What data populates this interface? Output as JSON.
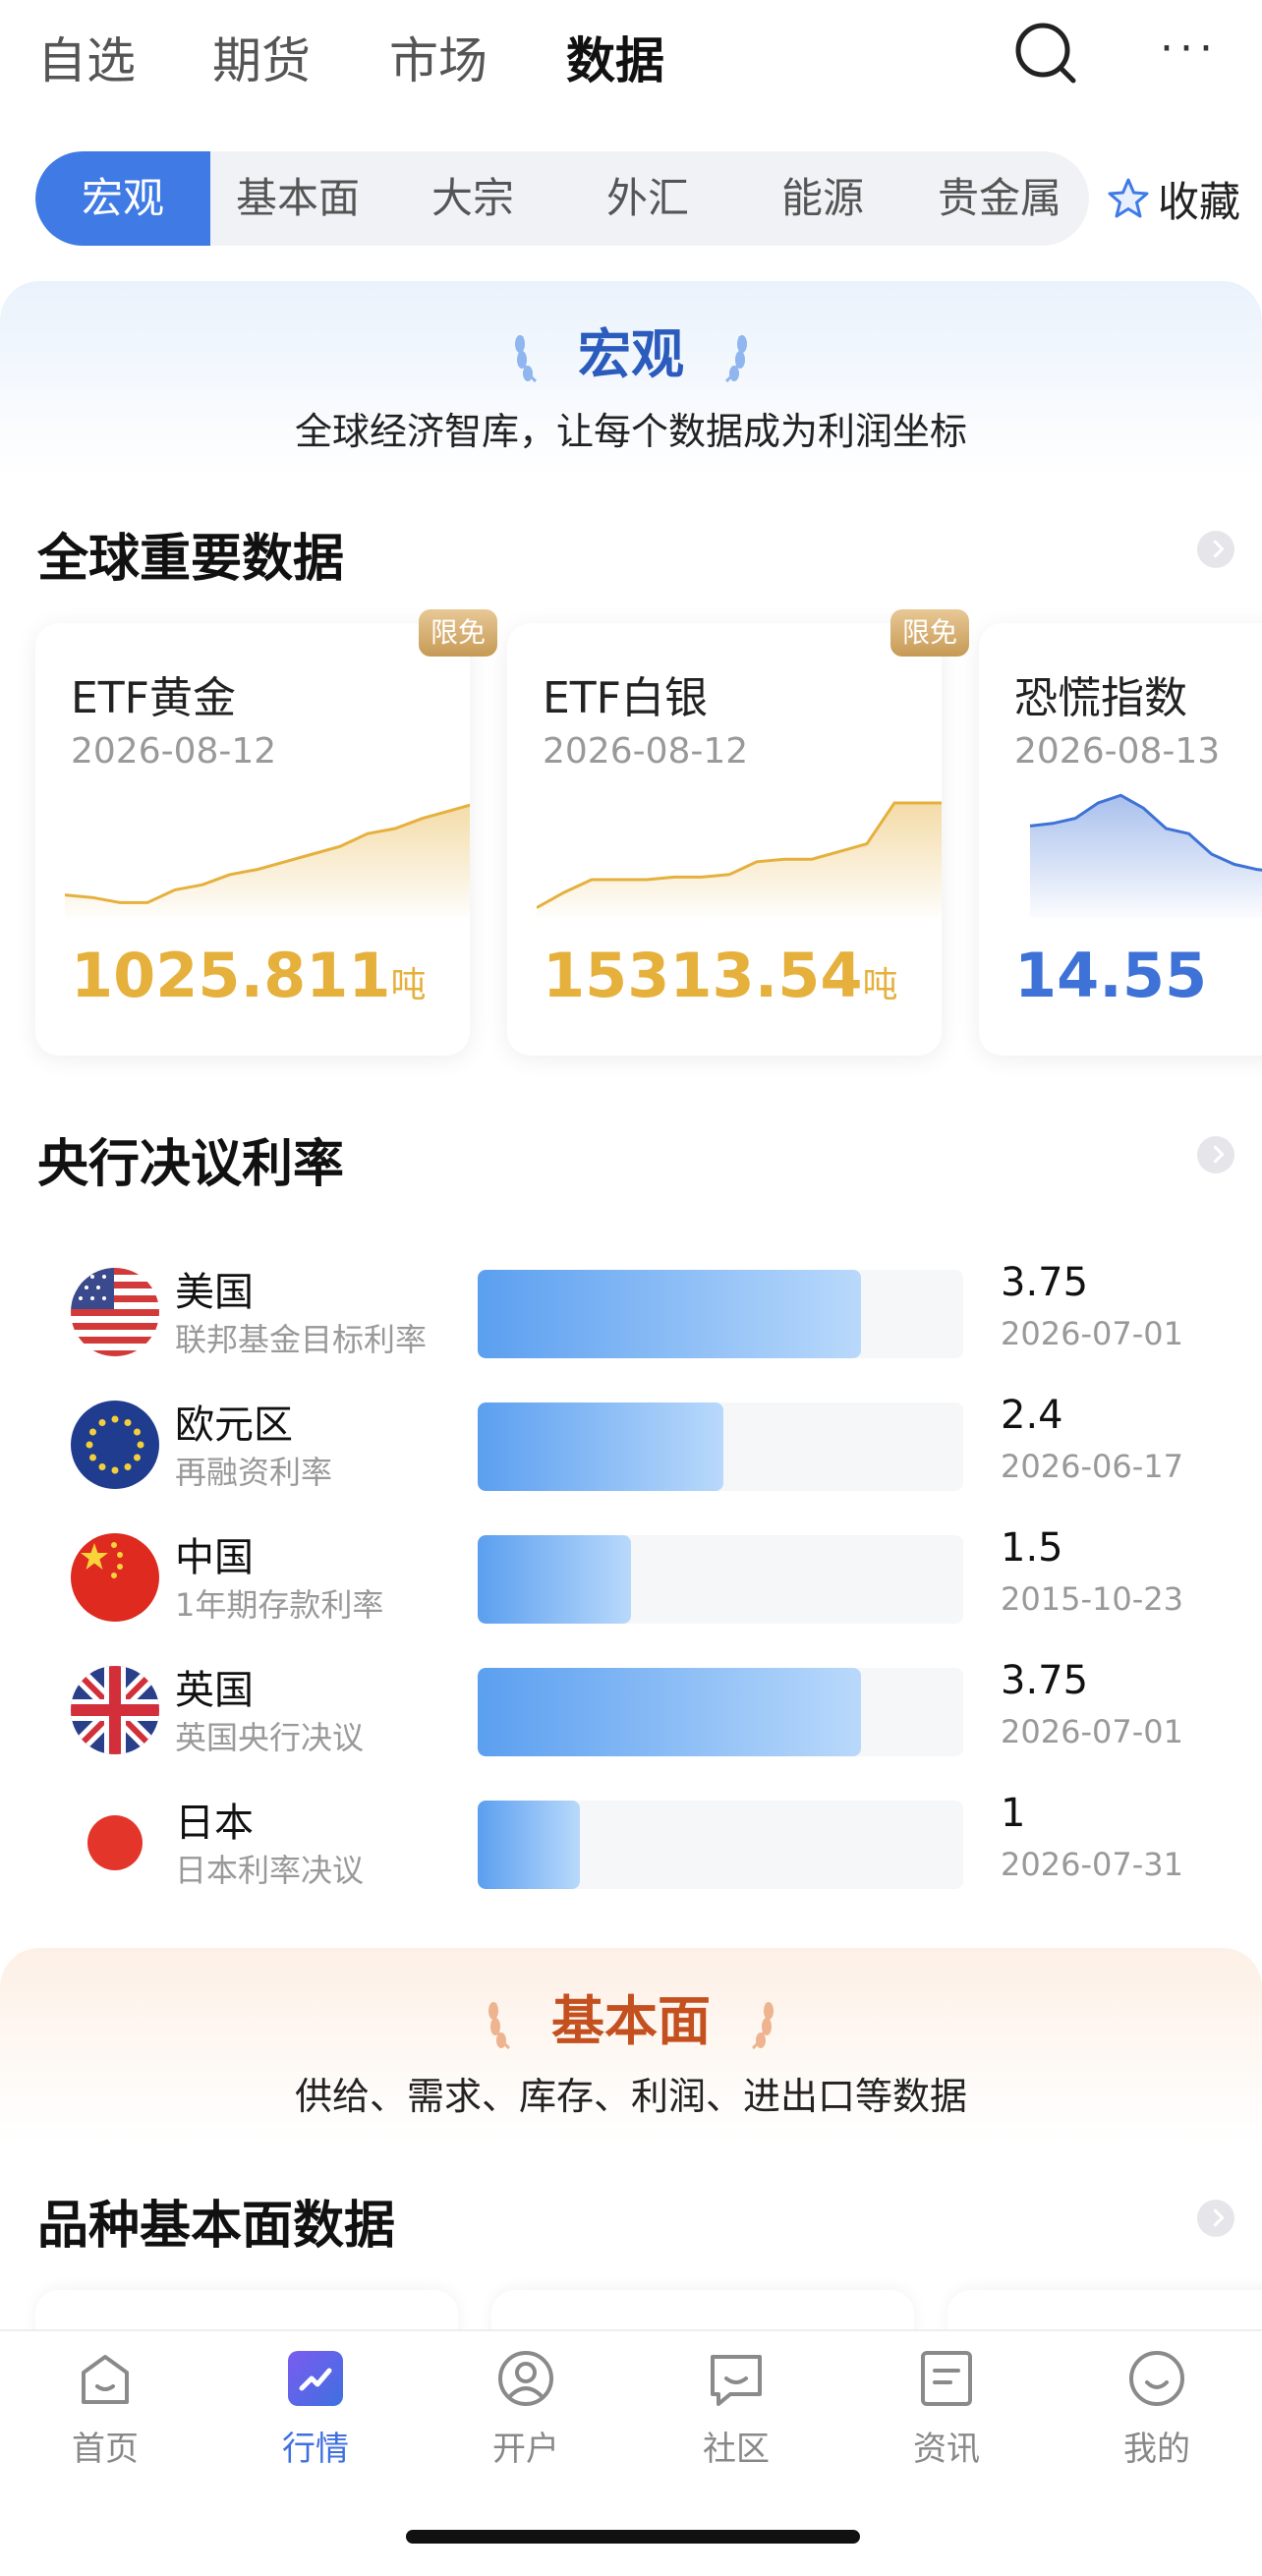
{
  "top_tabs": [
    "自选",
    "期货",
    "市场",
    "数据"
  ],
  "categories": [
    "宏观",
    "基本面",
    "大宗",
    "外汇",
    "能源",
    "贵金属"
  ],
  "favorite_label": "收藏",
  "hero": {
    "title": "宏观",
    "subtitle": "全球经济智库，让每个数据成为利润坐标"
  },
  "global_section": {
    "title": "全球重要数据"
  },
  "cards": [
    {
      "name": "ETF黄金",
      "date": "2026-08-12",
      "value": "1025.811",
      "unit": "吨",
      "badge": "限免",
      "color": "#e6b03d",
      "trend": [
        0.18,
        0.16,
        0.12,
        0.12,
        0.22,
        0.26,
        0.34,
        0.38,
        0.44,
        0.5,
        0.56,
        0.66,
        0.7,
        0.78,
        0.84,
        0.9
      ]
    },
    {
      "name": "ETF白银",
      "date": "2026-08-12",
      "value": "15313.54",
      "unit": "吨",
      "badge": "限免",
      "color": "#e6b03d",
      "trend": [
        0.08,
        0.2,
        0.3,
        0.3,
        0.3,
        0.32,
        0.32,
        0.34,
        0.44,
        0.46,
        0.46,
        0.52,
        0.58,
        0.9,
        0.9,
        0.9
      ]
    },
    {
      "name": "恐慌指数",
      "date": "2026-08-13",
      "value": "14.55",
      "unit": "",
      "badge": "",
      "color": "#3f72d6",
      "trend": [
        0.72,
        0.74,
        0.78,
        0.9,
        0.96,
        0.86,
        0.7,
        0.66,
        0.5,
        0.42,
        0.38,
        0.36,
        0.34,
        0.34
      ]
    }
  ],
  "rates_section": {
    "title": "央行决议利率"
  },
  "rates": [
    {
      "country": "美国",
      "desc": "联邦基金目标利率",
      "value": "3.75",
      "date": "2026-07-01",
      "level": 3.75,
      "flag": "us-flag-icon"
    },
    {
      "country": "欧元区",
      "desc": "再融资利率",
      "value": "2.4",
      "date": "2026-06-17",
      "level": 2.4,
      "flag": "eu-flag-icon"
    },
    {
      "country": "中国",
      "desc": "1年期存款利率",
      "value": "1.5",
      "date": "2015-10-23",
      "level": 1.5,
      "flag": "cn-flag-icon"
    },
    {
      "country": "英国",
      "desc": "英国央行决议",
      "value": "3.75",
      "date": "2026-07-01",
      "level": 3.75,
      "flag": "uk-flag-icon"
    },
    {
      "country": "日本",
      "desc": "日本利率决议",
      "value": "1",
      "date": "2026-07-31",
      "level": 1,
      "flag": "jp-flag-icon"
    }
  ],
  "rates_scale_max": 4.75,
  "fund_hero": {
    "title": "基本面",
    "subtitle": "供给、需求、库存、利润、进出口等数据"
  },
  "fund_section": {
    "title": "品种基本面数据"
  },
  "bottom_nav": [
    {
      "label": "首页",
      "icon": "home-icon"
    },
    {
      "label": "行情",
      "icon": "market-icon"
    },
    {
      "label": "开户",
      "icon": "account-icon"
    },
    {
      "label": "社区",
      "icon": "community-icon"
    },
    {
      "label": "资讯",
      "icon": "news-icon"
    },
    {
      "label": "我的",
      "icon": "profile-icon"
    }
  ],
  "colors": {
    "accent": "#3f7ae5",
    "gold": "#e6b03d",
    "blue_value": "#3f72d6",
    "orange_title": "#c4501f"
  }
}
